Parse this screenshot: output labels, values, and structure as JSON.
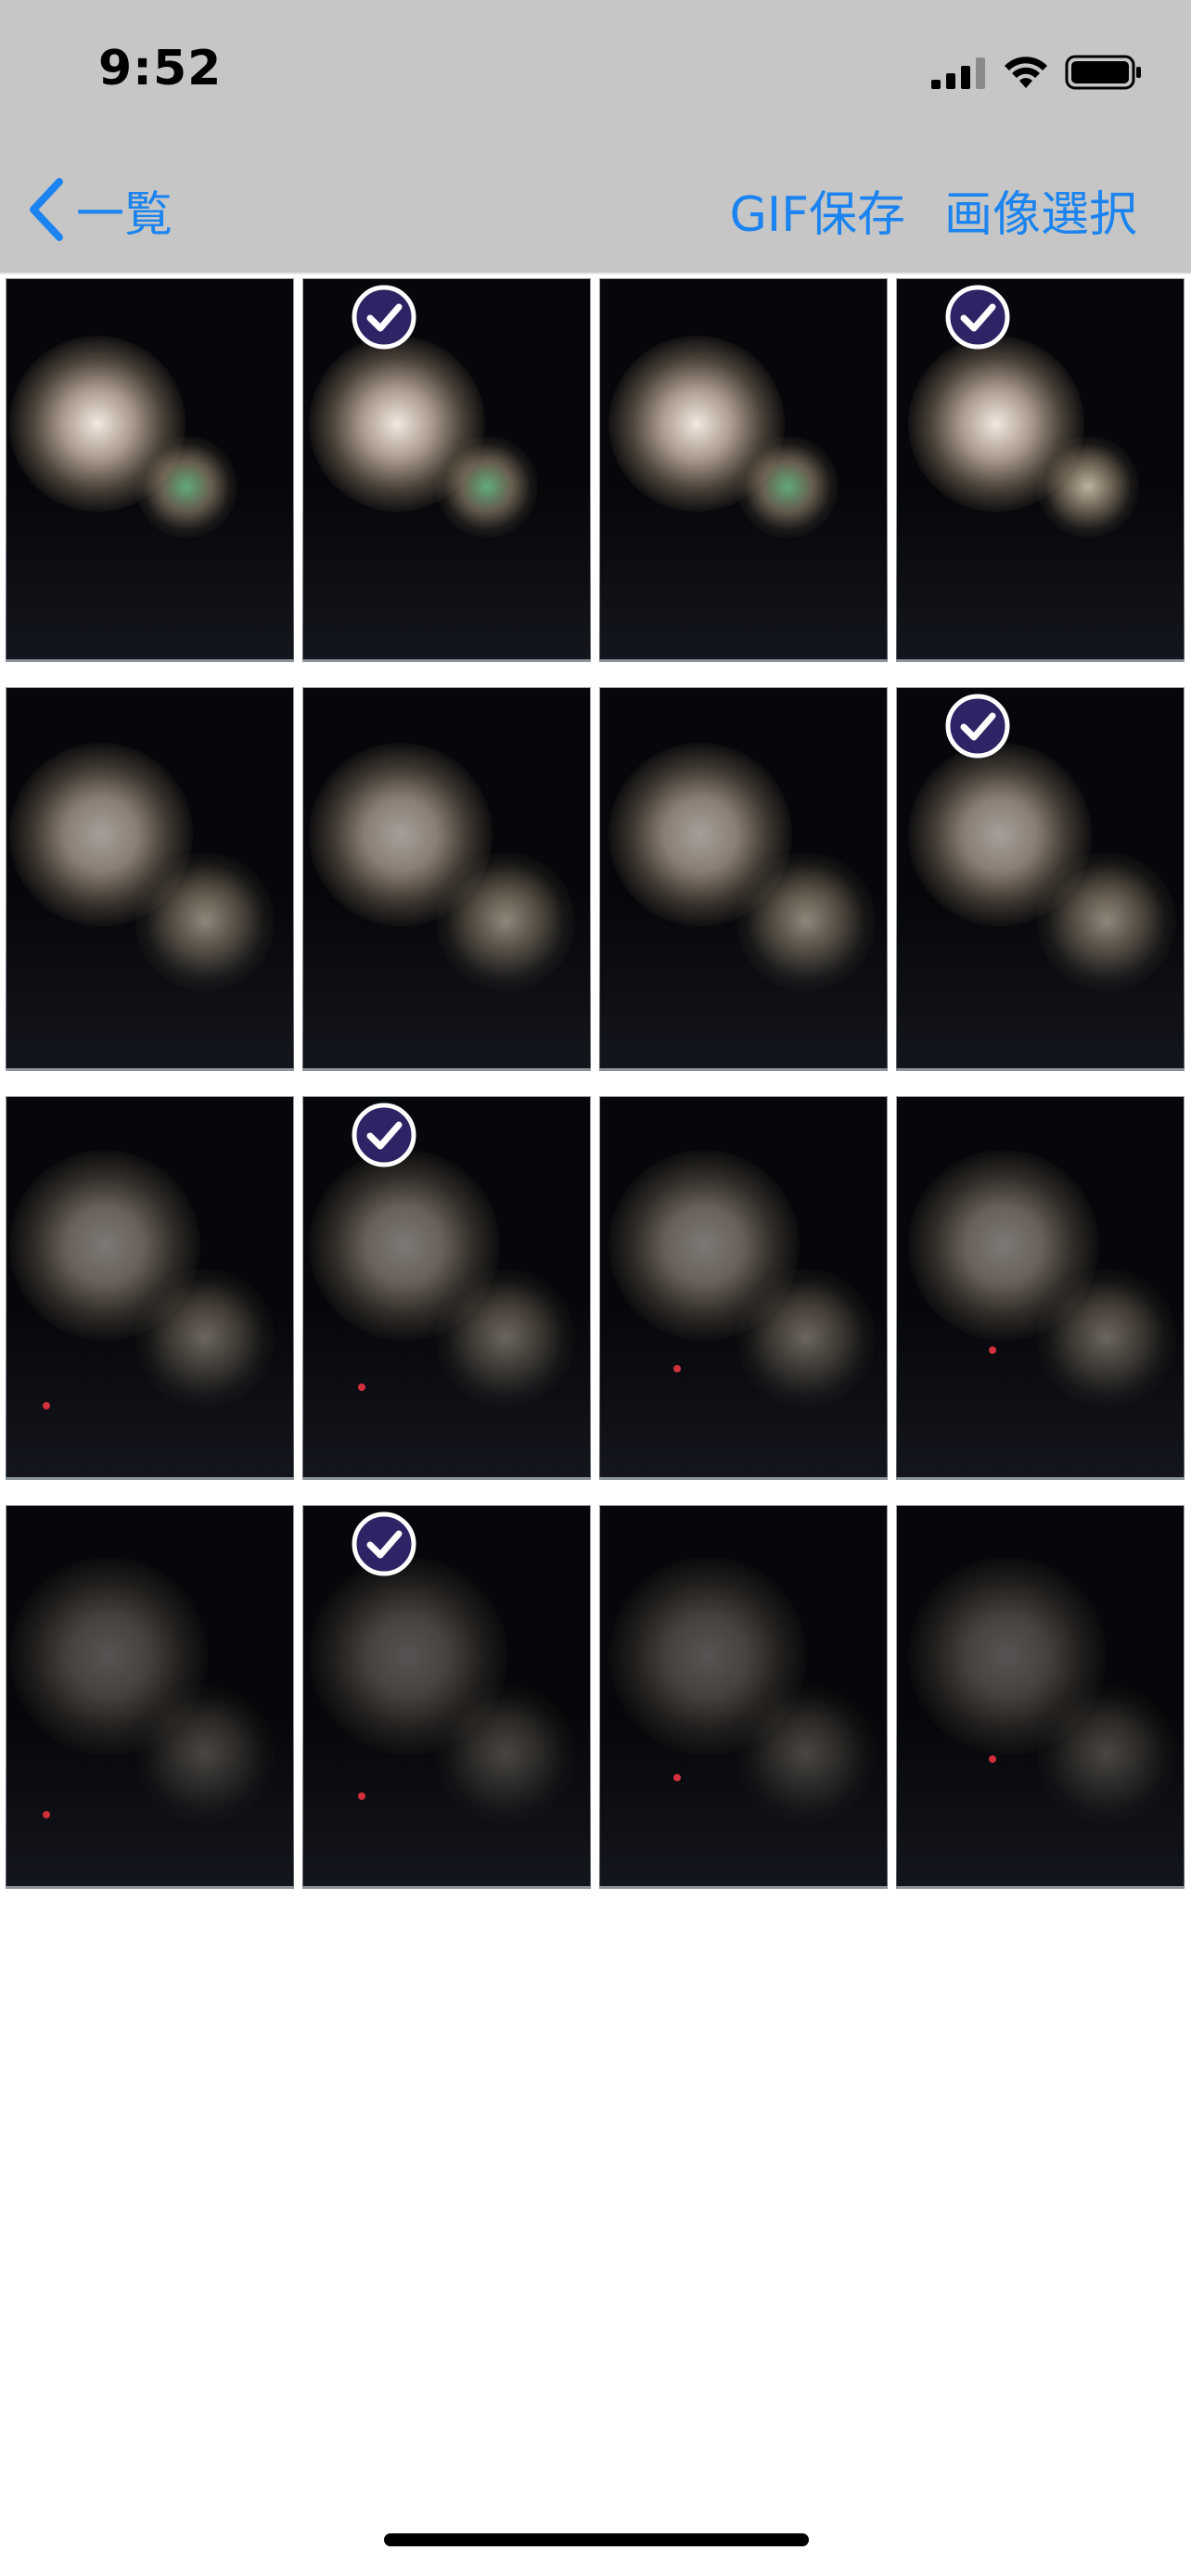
{
  "status_bar": {
    "time": "9:52",
    "icons": [
      "cellular-signal-icon",
      "wifi-icon",
      "battery-icon"
    ]
  },
  "nav": {
    "back_label": "一覧",
    "save_gif_label": "GIF保存",
    "select_images_label": "画像選択",
    "accent_color": "#1b84f0"
  },
  "colors": {
    "nav_background": "#c6c6c6",
    "check_badge": "#2e2364",
    "thumbnail_background": "#06070a"
  },
  "grid": {
    "columns": 4,
    "thumbnails": [
      {
        "index": 1,
        "selected": false
      },
      {
        "index": 2,
        "selected": true
      },
      {
        "index": 3,
        "selected": false
      },
      {
        "index": 4,
        "selected": true
      },
      {
        "index": 5,
        "selected": false
      },
      {
        "index": 6,
        "selected": false
      },
      {
        "index": 7,
        "selected": false
      },
      {
        "index": 8,
        "selected": true
      },
      {
        "index": 9,
        "selected": false
      },
      {
        "index": 10,
        "selected": true
      },
      {
        "index": 11,
        "selected": false
      },
      {
        "index": 12,
        "selected": false
      },
      {
        "index": 13,
        "selected": false
      },
      {
        "index": 14,
        "selected": true
      },
      {
        "index": 15,
        "selected": false
      },
      {
        "index": 16,
        "selected": false
      }
    ]
  }
}
